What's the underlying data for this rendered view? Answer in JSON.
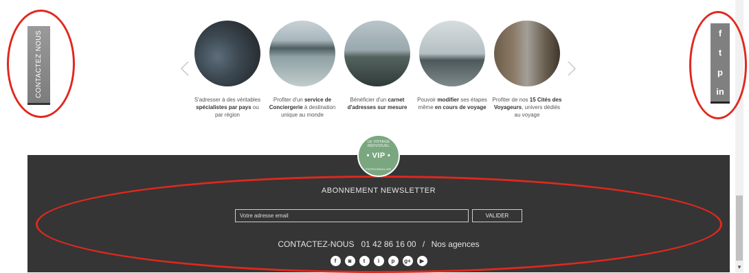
{
  "contact_tab": {
    "label": "CONTACTEZ NOUS"
  },
  "features": [
    {
      "text_a": "S'adresser à des véritables ",
      "bold_a": "spécialistes par pays",
      "text_b": " ou par région"
    },
    {
      "text_a": "Profiter d'un ",
      "bold_a": "service de Conciergerie",
      "text_b": " à destination unique au monde"
    },
    {
      "text_a": "Bénéficier d'un ",
      "bold_a": "carnet d'adresses sur mesure",
      "text_b": ""
    },
    {
      "text_a": "Pouvoir ",
      "bold_a": "modifier",
      "text_b": " ses étapes même ",
      "bold_b": "en cours de voyage"
    },
    {
      "text_a": "Profiter de nos ",
      "bold_a": "15 Cités des Voyageurs",
      "text_b": ", univers dédiés au voyage"
    }
  ],
  "badge": {
    "center": "• VIP •",
    "top": "LE VOYAGE INDIVIDUEL",
    "bottom": "PERSONNALISÉ"
  },
  "newsletter": {
    "title": "ABONNEMENT NEWSLETTER",
    "email_placeholder": "Votre adresse email",
    "submit_label": "VALIDER"
  },
  "contact": {
    "label": "CONTACTEZ-NOUS",
    "phone": "01 42 86 16 00",
    "separator": "/",
    "agencies": "Nos agences"
  },
  "side_social": [
    {
      "icon": "facebook-icon",
      "glyph": "f"
    },
    {
      "icon": "twitter-icon",
      "glyph": "t"
    },
    {
      "icon": "pinterest-icon",
      "glyph": "p"
    },
    {
      "icon": "linkedin-icon",
      "glyph": "in"
    }
  ],
  "footer_social": [
    {
      "icon": "facebook-icon",
      "glyph": "f"
    },
    {
      "icon": "instagram-icon",
      "glyph": "◙"
    },
    {
      "icon": "twitter-icon",
      "glyph": "t"
    },
    {
      "icon": "info-icon",
      "glyph": "i"
    },
    {
      "icon": "pinterest-icon",
      "glyph": "p"
    },
    {
      "icon": "googleplus-icon",
      "glyph": "g+"
    },
    {
      "icon": "youtube-icon",
      "glyph": "▶"
    }
  ],
  "colors": {
    "footer_bg": "#353535",
    "annotation": "#e0281e",
    "badge": "#7aa780"
  }
}
